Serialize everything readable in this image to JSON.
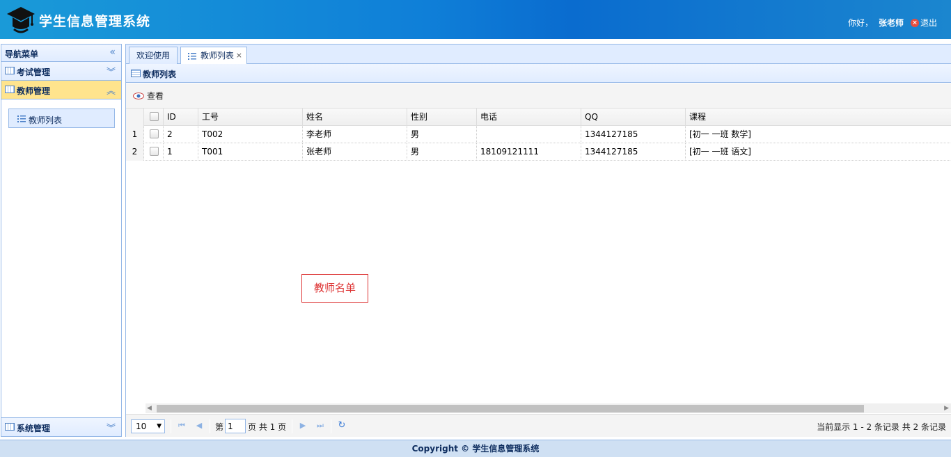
{
  "header": {
    "title": "学生信息管理系统",
    "greeting": "你好，",
    "username": "张老师",
    "logout": "退出"
  },
  "sidebar": {
    "title": "导航菜单",
    "panels": [
      {
        "label": "考试管理",
        "state": "collapsed"
      },
      {
        "label": "教师管理",
        "state": "expanded"
      },
      {
        "label": "系统管理",
        "state": "collapsed"
      }
    ],
    "menu_items": [
      {
        "label": "教师列表"
      }
    ]
  },
  "tabs": [
    {
      "label": "欢迎使用",
      "active": false
    },
    {
      "label": "教师列表",
      "active": true,
      "closable": true
    }
  ],
  "panel": {
    "title": "教师列表"
  },
  "toolbar": {
    "view_label": "查看"
  },
  "grid": {
    "columns": [
      "ID",
      "工号",
      "姓名",
      "性别",
      "电话",
      "QQ",
      "课程"
    ],
    "rows": [
      {
        "num": "1",
        "id": "2",
        "no": "T002",
        "name": "李老师",
        "sex": "男",
        "tel": "",
        "qq": "1344127185",
        "course": "[初一 一班 数学]"
      },
      {
        "num": "2",
        "id": "1",
        "no": "T001",
        "name": "张老师",
        "sex": "男",
        "tel": "18109121111",
        "qq": "1344127185",
        "course": "[初一 一班 语文]"
      }
    ]
  },
  "stamp": "教师名单",
  "pager": {
    "page_size": "10",
    "page_prefix": "第",
    "page_value": "1",
    "page_suffix": "页 共 1 页",
    "info": "当前显示 1 - 2 条记录 共 2 条记录"
  },
  "footer": "Copyright © 学生信息管理系统",
  "colors": {
    "header_start": "#1a9ad8",
    "header_end": "#0a6ccf",
    "active_panel": "#ffe48d",
    "border": "#95b8e7",
    "stamp": "#dd3333"
  }
}
